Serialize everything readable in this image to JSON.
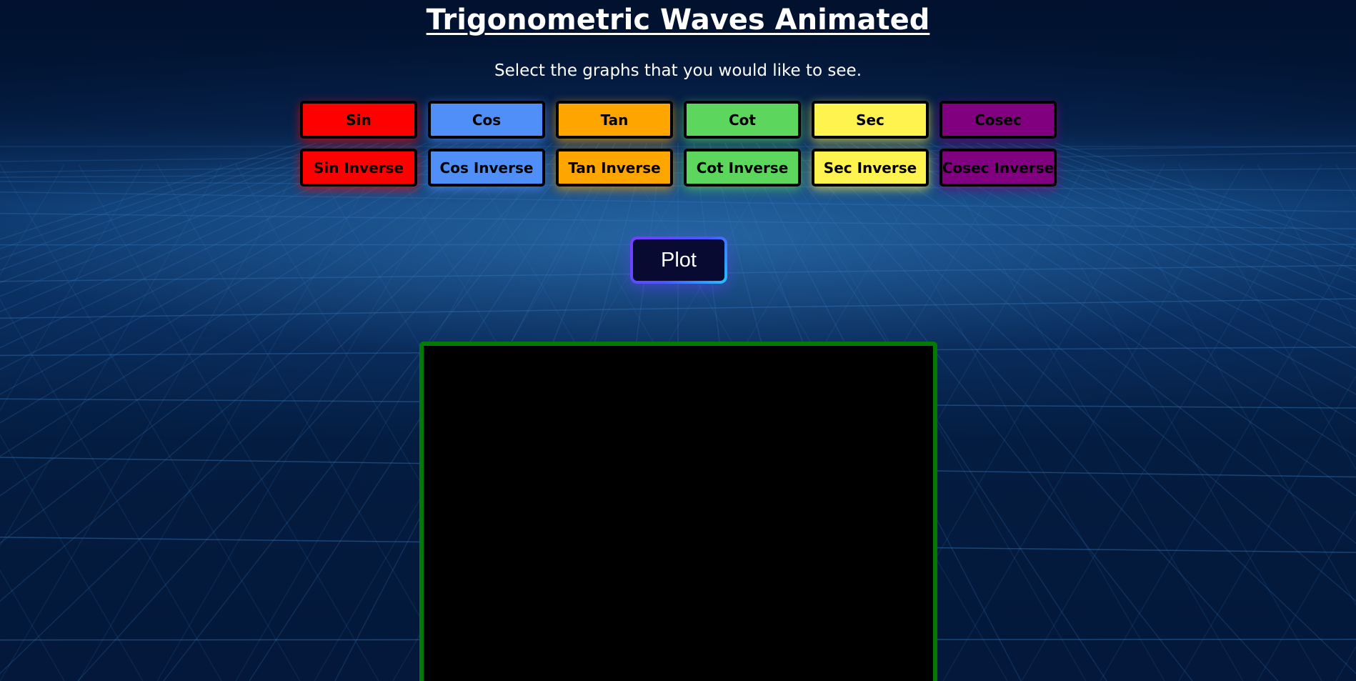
{
  "page": {
    "title": "Trigonometric Waves Animated",
    "subtitle": "Select the graphs that you would like to see."
  },
  "functions": [
    {
      "label": "Sin",
      "color": "#ff0000"
    },
    {
      "label": "Cos",
      "color": "#4f8ff7"
    },
    {
      "label": "Tan",
      "color": "#ffa500"
    },
    {
      "label": "Cot",
      "color": "#5cd65c"
    },
    {
      "label": "Sec",
      "color": "#fff44f"
    },
    {
      "label": "Cosec",
      "color": "#800080"
    },
    {
      "label": "Sin Inverse",
      "color": "#ff0000"
    },
    {
      "label": "Cos Inverse",
      "color": "#4f8ff7"
    },
    {
      "label": "Tan Inverse",
      "color": "#ffa500"
    },
    {
      "label": "Cot Inverse",
      "color": "#5cd65c"
    },
    {
      "label": "Sec Inverse",
      "color": "#fff44f"
    },
    {
      "label": "Cosec Inverse",
      "color": "#800080"
    }
  ],
  "plot": {
    "label": "Plot"
  },
  "colors": {
    "canvas_border": "#037a04",
    "canvas_background": "#000000",
    "page_background": "#02183a"
  }
}
